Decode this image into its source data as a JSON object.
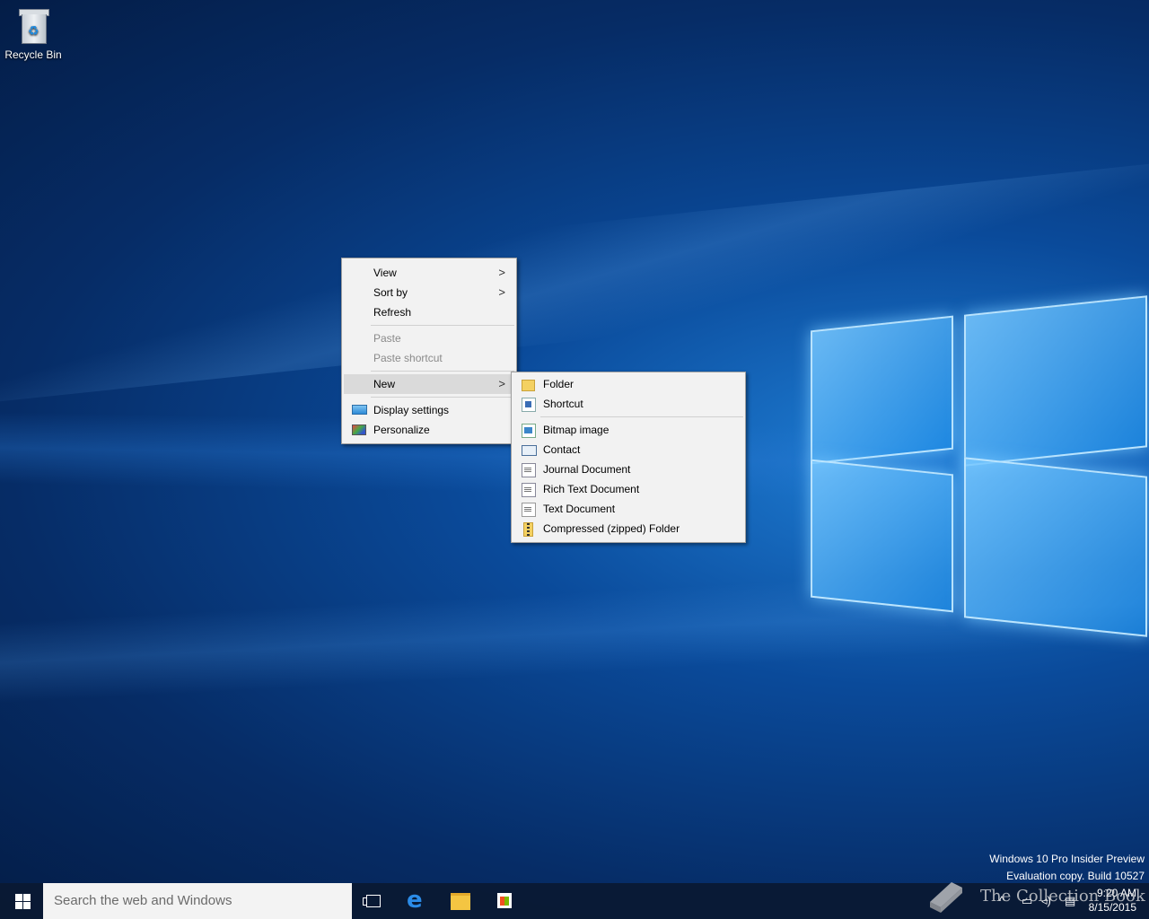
{
  "desktop": {
    "icons": [
      {
        "label": "Recycle Bin",
        "icon": "recycle-bin-icon"
      }
    ]
  },
  "context_menu": {
    "items": [
      {
        "label": "View",
        "submenu": true
      },
      {
        "label": "Sort by",
        "submenu": true
      },
      {
        "label": "Refresh"
      },
      {
        "label": "Paste",
        "disabled": true
      },
      {
        "label": "Paste shortcut",
        "disabled": true
      },
      {
        "label": "New",
        "submenu": true,
        "highlighted": true
      },
      {
        "label": "Display settings",
        "icon": "display-settings-icon"
      },
      {
        "label": "Personalize",
        "icon": "personalize-icon"
      }
    ],
    "submenu_arrow": ">"
  },
  "new_submenu": {
    "items": [
      {
        "label": "Folder",
        "icon": "folder-icon"
      },
      {
        "label": "Shortcut",
        "icon": "shortcut-icon"
      },
      {
        "label": "Bitmap image",
        "icon": "bitmap-icon"
      },
      {
        "label": "Contact",
        "icon": "contact-icon"
      },
      {
        "label": "Journal Document",
        "icon": "journal-icon"
      },
      {
        "label": "Rich Text Document",
        "icon": "rich-text-icon"
      },
      {
        "label": "Text Document",
        "icon": "text-document-icon"
      },
      {
        "label": "Compressed (zipped) Folder",
        "icon": "zip-folder-icon"
      }
    ]
  },
  "watermark": {
    "line1": "Windows 10 Pro Insider Preview",
    "line2": "Evaluation copy. Build 10527"
  },
  "taskbar": {
    "search_placeholder": "Search the web and Windows",
    "pinned": [
      "task-view-icon",
      "edge-icon",
      "file-explorer-icon",
      "store-icon"
    ],
    "clock_time": "9:20 AM",
    "clock_date": "8/15/2015",
    "tray_icons": [
      "chevron-up-icon",
      "network-icon",
      "volume-icon",
      "action-center-icon"
    ]
  },
  "site_watermark": "The Collection Book"
}
